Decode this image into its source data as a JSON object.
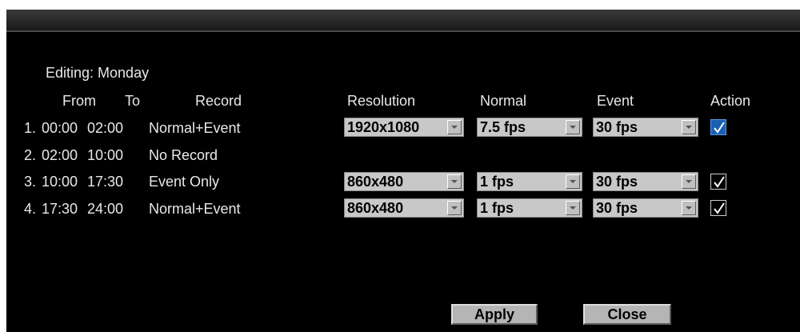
{
  "editing_label": "Editing: Monday",
  "headers": {
    "from": "From",
    "to": "To",
    "record": "Record",
    "resolution": "Resolution",
    "normal": "Normal",
    "event": "Event",
    "action": "Action"
  },
  "rows": [
    {
      "num": "1.",
      "from": "00:00",
      "to": "02:00",
      "record": "Normal+Event",
      "resolution": "1920x1080",
      "normal": "7.5 fps",
      "event": "30 fps",
      "action_checked": true
    },
    {
      "num": "2.",
      "from": "02:00",
      "to": "10:00",
      "record": "No Record"
    },
    {
      "num": "3.",
      "from": "10:00",
      "to": "17:30",
      "record": "Event Only",
      "resolution": "860x480",
      "normal": "1 fps",
      "event": "30 fps",
      "action_checked": true
    },
    {
      "num": "4.",
      "from": "17:30",
      "to": "24:00",
      "record": "Normal+Event",
      "resolution": "860x480",
      "normal": "1 fps",
      "event": "30 fps",
      "action_checked": true
    }
  ],
  "buttons": {
    "apply": "Apply",
    "close": "Close"
  },
  "colors": {
    "background": "#000000",
    "text": "#e8e8e8",
    "select": "#c8c8c8",
    "checkbox_active": "#1a5fb4"
  }
}
